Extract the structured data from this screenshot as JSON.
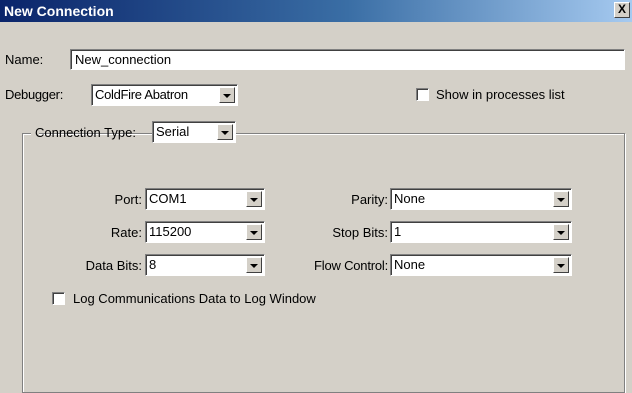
{
  "window": {
    "title": "New Connection",
    "close_glyph": "X"
  },
  "name": {
    "label": "Name:",
    "value": "New_connection"
  },
  "debugger": {
    "label": "Debugger:",
    "selected": "ColdFire Abatron"
  },
  "show_processes": {
    "label": "Show in processes list",
    "checked": false
  },
  "connection_type": {
    "label": "Connection Type:",
    "selected": "Serial"
  },
  "serial": {
    "port": {
      "label": "Port:",
      "selected": "COM1"
    },
    "rate": {
      "label": "Rate:",
      "selected": "115200"
    },
    "data_bits": {
      "label": "Data Bits:",
      "selected": "8"
    },
    "parity": {
      "label": "Parity:",
      "selected": "None"
    },
    "stop_bits": {
      "label": "Stop Bits:",
      "selected": "1"
    },
    "flow_control": {
      "label": "Flow Control:",
      "selected": "None"
    }
  },
  "log_comms": {
    "label": "Log Communications Data to Log Window",
    "checked": false
  }
}
